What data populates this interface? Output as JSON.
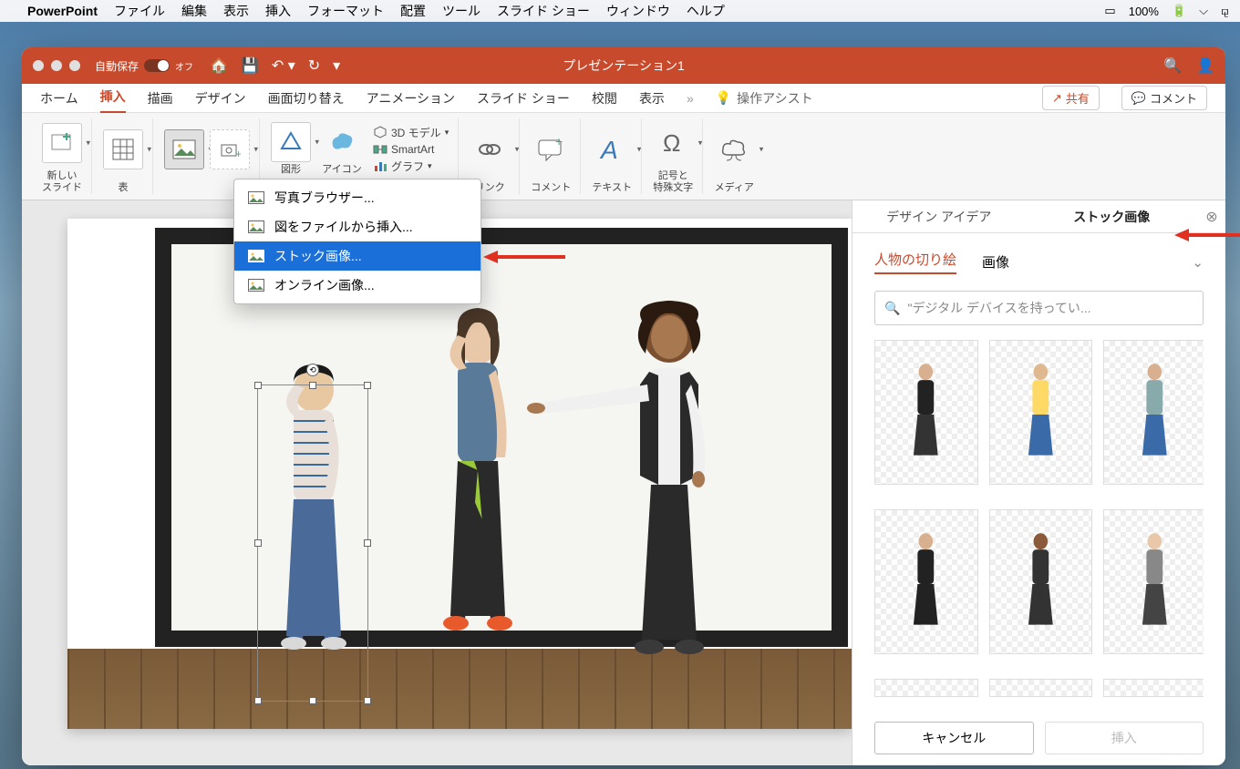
{
  "menubar": {
    "app": "PowerPoint",
    "items": [
      "ファイル",
      "編集",
      "表示",
      "挿入",
      "フォーマット",
      "配置",
      "ツール",
      "スライド ショー",
      "ウィンドウ",
      "ヘルプ"
    ],
    "battery": "100%"
  },
  "titlebar": {
    "autosave_label": "自動保存",
    "autosave_state": "オフ",
    "title": "プレゼンテーション1"
  },
  "ribbon_tabs": [
    "ホーム",
    "挿入",
    "描画",
    "デザイン",
    "画面切り替え",
    "アニメーション",
    "スライド ショー",
    "校閲",
    "表示"
  ],
  "ribbon_active": "挿入",
  "assist_label": "操作アシスト",
  "share_label": "共有",
  "comment_label": "コメント",
  "ribbon_groups": {
    "new_slide": "新しい\nスライド",
    "table": "表",
    "shapes": "図形",
    "icons": "アイコン",
    "model3d": "3D モデル",
    "smartart": "SmartArt",
    "chart": "グラフ",
    "link": "リンク",
    "comment": "コメント",
    "text": "テキスト",
    "symbol": "記号と\n特殊文字",
    "media": "メディア"
  },
  "picture_menu": {
    "items": [
      {
        "label": "写真ブラウザー..."
      },
      {
        "label": "図をファイルから挿入..."
      },
      {
        "label": "ストック画像..."
      },
      {
        "label": "オンライン画像..."
      }
    ],
    "selected_index": 2
  },
  "panel": {
    "tab_design": "デザイン アイデア",
    "tab_stock": "ストック画像",
    "cat_cutout": "人物の切り絵",
    "cat_image": "画像",
    "search_placeholder": "\"デジタル デバイスを持ってい...",
    "cancel": "キャンセル",
    "insert": "挿入"
  },
  "thumb_colors": [
    {
      "head": "#d8b090",
      "body": "#222",
      "legs": "#333"
    },
    {
      "head": "#e0b890",
      "body": "#ffd966",
      "legs": "#3a6aa8"
    },
    {
      "head": "#d8b090",
      "body": "#8aa",
      "legs": "#3a6aa8"
    },
    {
      "head": "#c89878",
      "body": "#fff",
      "legs": "#222"
    },
    {
      "head": "#d8b090",
      "body": "#222",
      "legs": "#222"
    },
    {
      "head": "#8a5a3a",
      "body": "#333",
      "legs": "#333"
    },
    {
      "head": "#e8c8a8",
      "body": "#888",
      "legs": "#444"
    },
    {
      "head": "#c89878",
      "body": "#1a2a5a",
      "legs": "#1a2a5a"
    }
  ]
}
